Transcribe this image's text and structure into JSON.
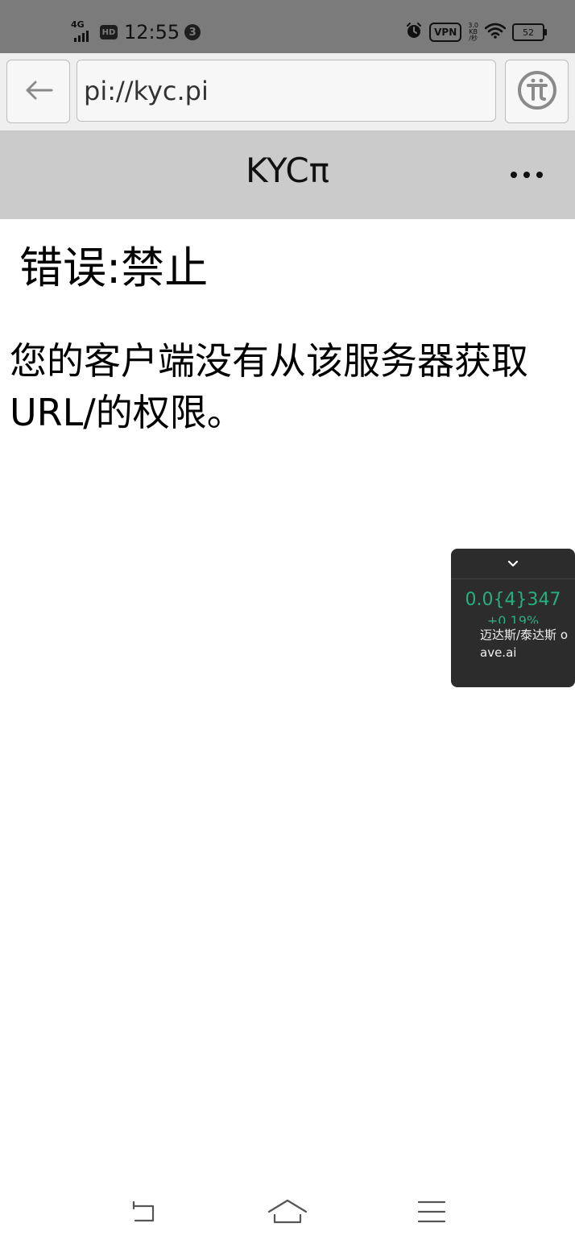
{
  "status_bar": {
    "network_type": "4G",
    "hd_label": "HD",
    "time": "12:55",
    "notification_count": "3",
    "vpn_label": "VPN",
    "net_speed_value": "3.0",
    "net_speed_unit": "KB",
    "net_speed_per": "/秒",
    "battery_level": "52",
    "icons": [
      "signal-icon",
      "alarm-icon",
      "wifi-icon",
      "battery-icon"
    ]
  },
  "browser": {
    "url": "pi://kyc.pi",
    "back_icon": "back-arrow-icon",
    "pi_icon": "pi-logo-icon"
  },
  "app_header": {
    "title": "KYCπ",
    "more_icon": "more-dots-icon"
  },
  "content": {
    "error_title": "错误:禁止",
    "error_message": "您的客户端没有从该服务器获取URL/的权限。"
  },
  "price_widget": {
    "collapse_icon": "chevron-down-icon",
    "price": "0.0{4}347",
    "change": "+0.19%",
    "pair": "迈达斯/泰达斯 o",
    "source": "ave.ai",
    "accent_color": "#27b07e"
  },
  "nav_bar": {
    "icons": [
      "back-nav-icon",
      "home-icon",
      "menu-icon"
    ]
  }
}
